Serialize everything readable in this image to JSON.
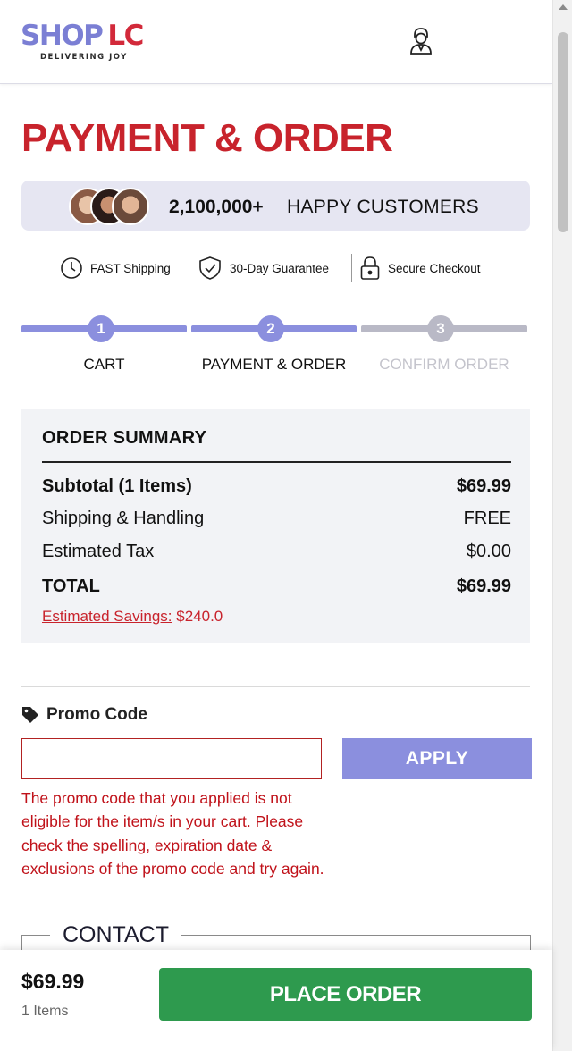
{
  "header": {
    "logo_text_shop": "SHOP",
    "logo_text_lc": "LC",
    "logo_tagline": "DELIVERING JOY",
    "account_icon": "user-account-icon"
  },
  "page": {
    "title": "PAYMENT & ORDER"
  },
  "customers": {
    "count": "2,100,000+",
    "label": "HAPPY CUSTOMERS"
  },
  "trust_badges": [
    {
      "label": "FAST Shipping",
      "icon": "clock-icon"
    },
    {
      "label": "30-Day Guarantee",
      "icon": "shield-check-icon"
    },
    {
      "label": "Secure Checkout",
      "icon": "lock-icon"
    }
  ],
  "steps": [
    {
      "number": "1",
      "label": "CART",
      "state": "complete"
    },
    {
      "number": "2",
      "label": "PAYMENT & ORDER",
      "state": "current"
    },
    {
      "number": "3",
      "label": "CONFIRM ORDER",
      "state": "upcoming"
    }
  ],
  "order_summary": {
    "title": "ORDER SUMMARY",
    "rows": [
      {
        "label": "Subtotal (1 Items)",
        "value": "$69.99"
      },
      {
        "label": "Shipping & Handling",
        "value": "FREE"
      },
      {
        "label": "Estimated Tax",
        "value": "$0.00"
      },
      {
        "label": "TOTAL",
        "value": "$69.99"
      }
    ],
    "savings_label": "Estimated Savings:",
    "savings_value": "$240.0"
  },
  "promo": {
    "label": "Promo Code",
    "icon": "tag-icon",
    "input_value": "",
    "input_placeholder": "",
    "apply_label": "APPLY",
    "error": "The promo code that you applied is not eligible for the item/s in your cart. Please check the spelling, expiration date & exclusions of the promo code and try again."
  },
  "contact": {
    "legend": "CONTACT"
  },
  "bottom_bar": {
    "price": "$69.99",
    "items": "1 Items",
    "place_order_label": "PLACE ORDER"
  },
  "colors": {
    "brand_red": "#c8232c",
    "brand_purple": "#7b7fd4",
    "step_active": "#8b8fde",
    "step_inactive": "#b9b9c6",
    "place_order_green": "#2e9a4e",
    "error_red": "#c0121a"
  }
}
